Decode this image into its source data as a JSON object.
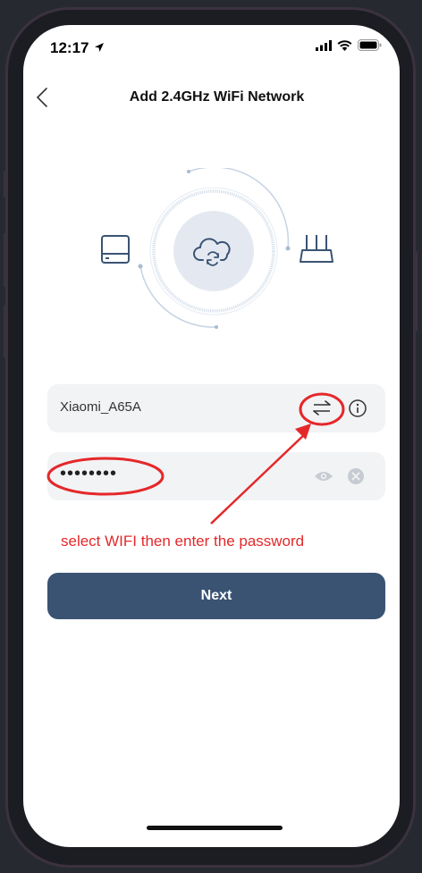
{
  "status_bar": {
    "time": "12:17"
  },
  "header": {
    "title": "Add 2.4GHz WiFi Network"
  },
  "form": {
    "ssid_value": "Xiaomi_A65A",
    "password_masked": "••••••••"
  },
  "annotation": {
    "text": "select WIFI then enter the password"
  },
  "actions": {
    "next_label": "Next"
  },
  "colors": {
    "primary_button": "#3a5373",
    "annotation_red": "#e4282a",
    "field_bg": "#f2f3f5"
  },
  "icons": [
    "location-arrow-icon",
    "cellular-signal-icon",
    "wifi-icon",
    "battery-icon",
    "back-icon",
    "hub-device-icon",
    "cloud-sync-icon",
    "router-icon",
    "switch-network-icon",
    "info-icon",
    "eye-icon",
    "clear-icon"
  ]
}
